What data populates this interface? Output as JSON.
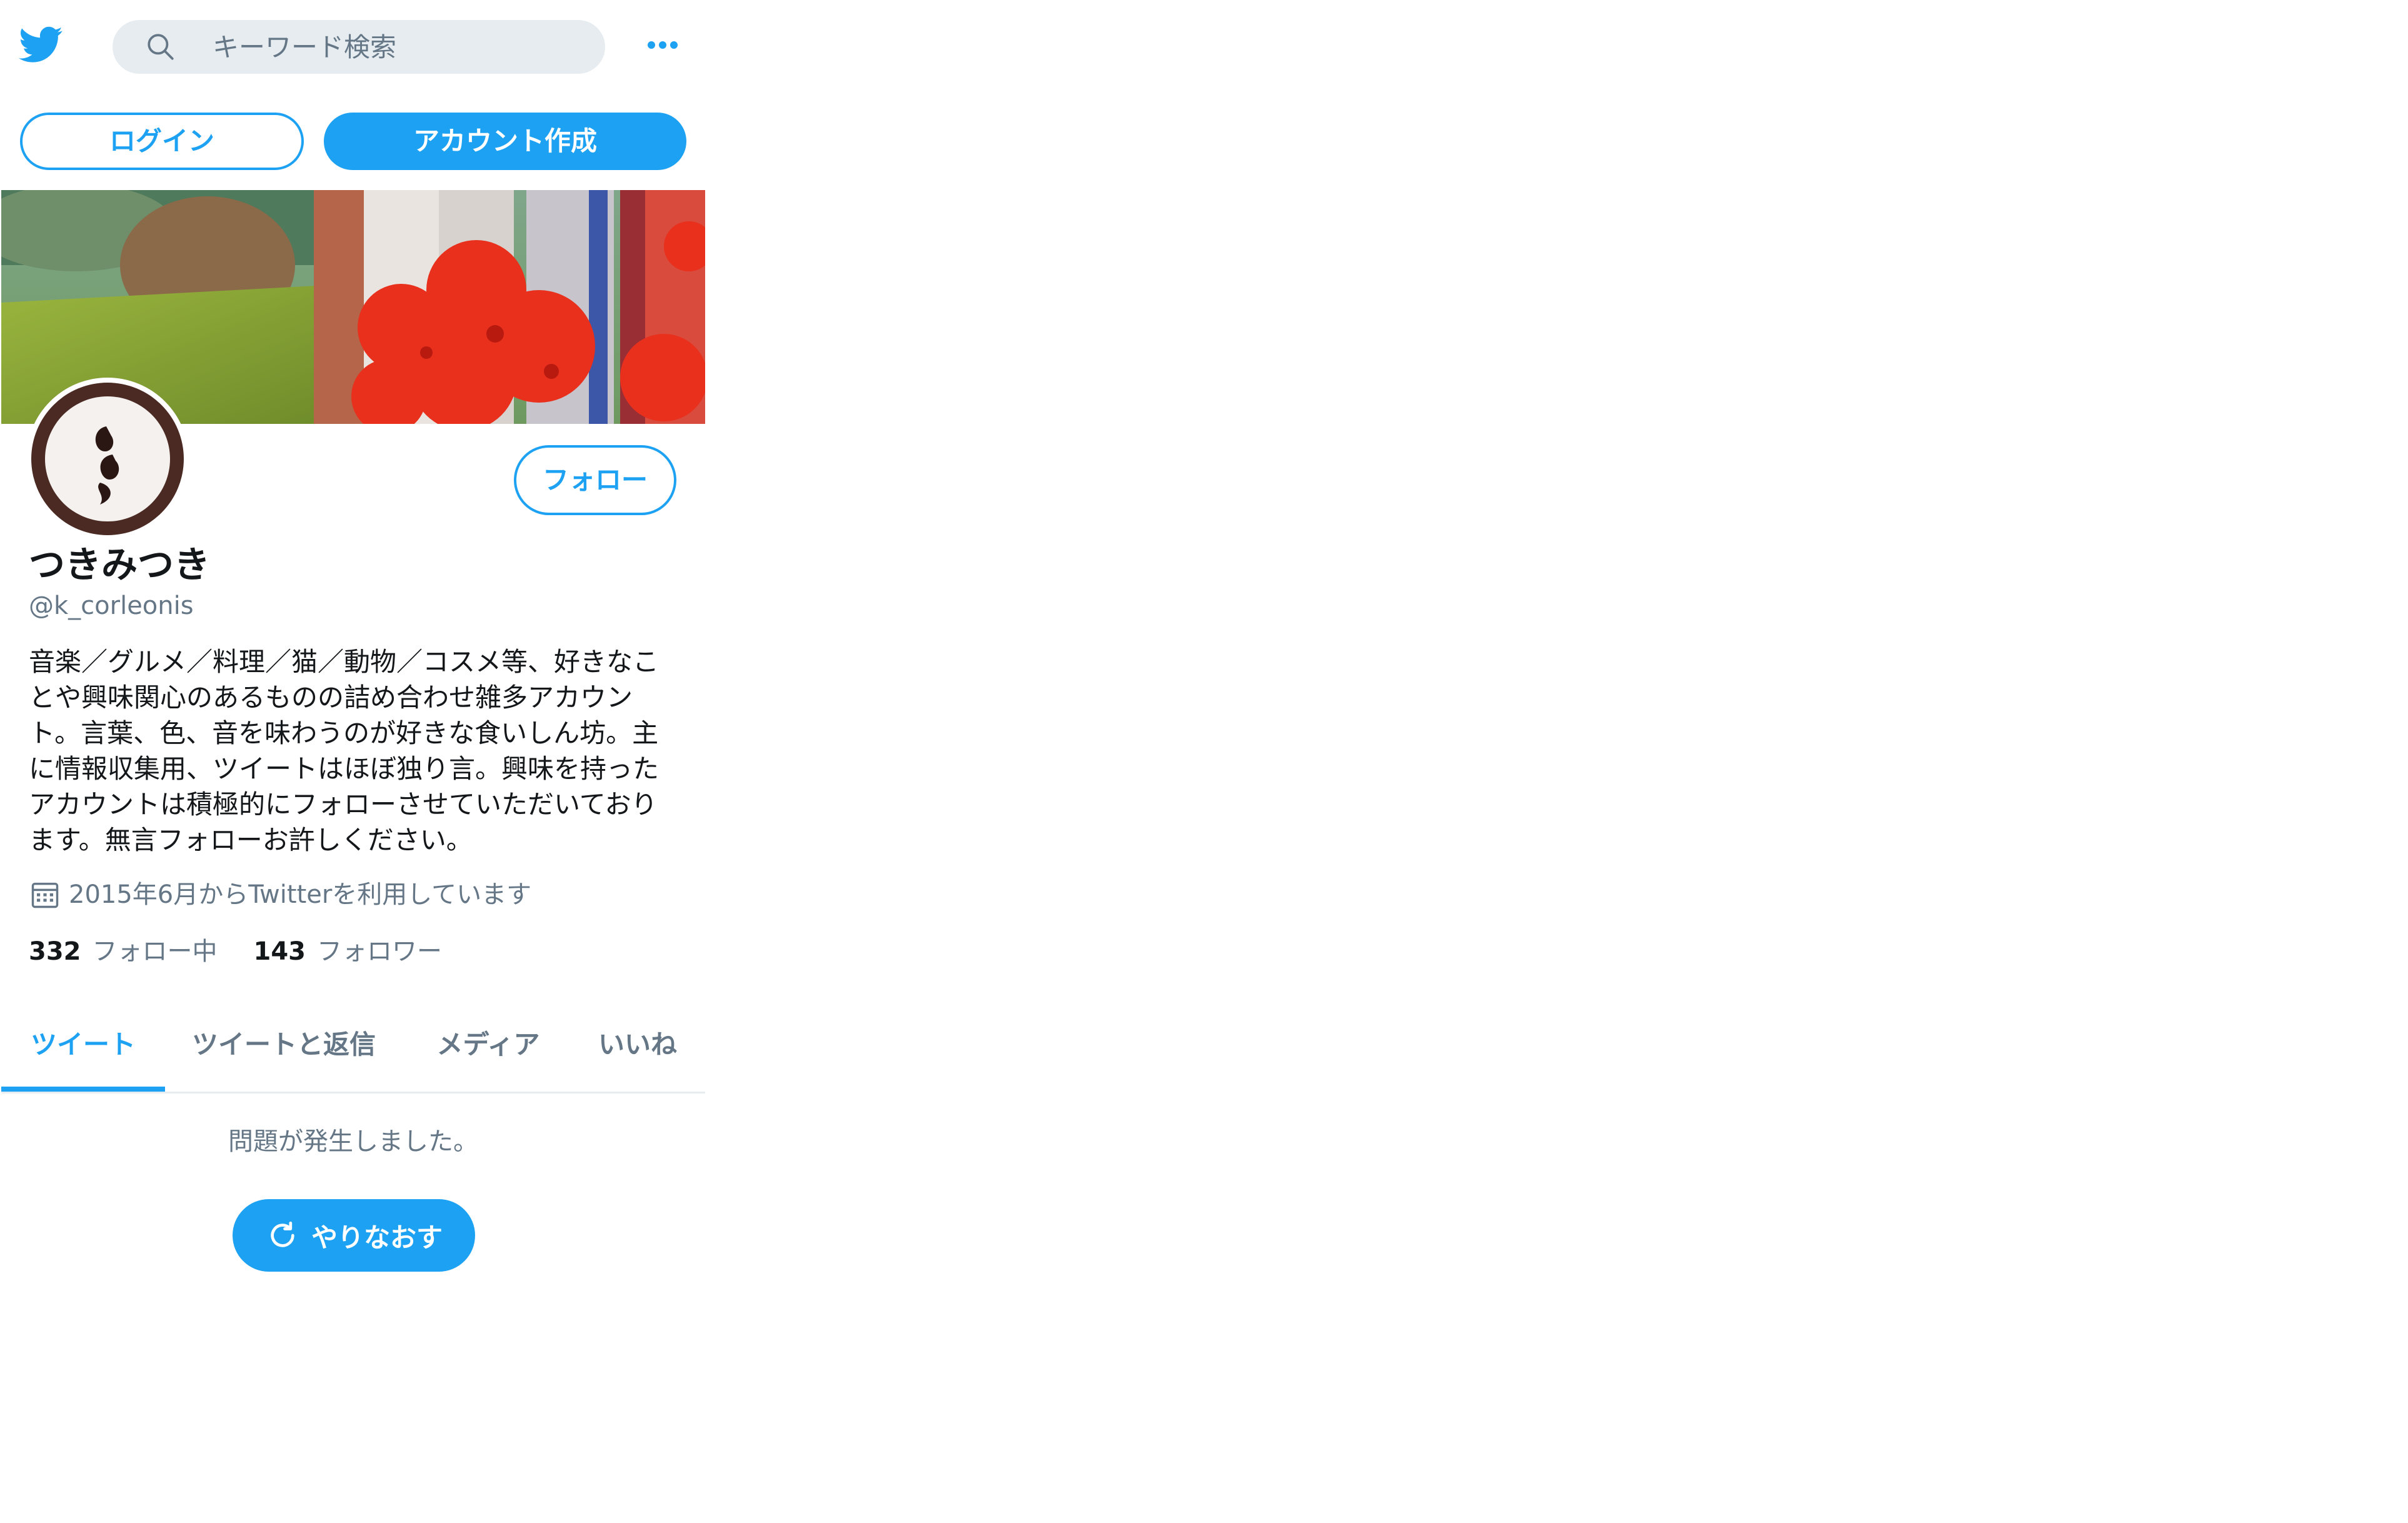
{
  "header": {
    "logo": "twitter-bird-icon",
    "search_placeholder": "キーワード検索",
    "more": "more-dots-icon"
  },
  "auth": {
    "login_label": "ログイン",
    "signup_label": "アカウント作成"
  },
  "profile": {
    "name": "つきみつき",
    "handle": "@k_corleonis",
    "follow_label": "フォロー",
    "bio": "音楽／グルメ／料理／猫／動物／コスメ等、好きなことや興味関心のあるものの詰め合わせ雑多アカウント。言葉、色、音を味わうのが好きな食いしん坊。主に情報収集用、ツイートはほぼ独り言。興味を持ったアカウントは積極的にフォローさせていただいております。無言フォローお許しください。",
    "joined": "2015年6月からTwitterを利用しています",
    "following_count": "332",
    "following_label": "フォロー中",
    "followers_count": "143",
    "followers_label": "フォロワー"
  },
  "tabs": [
    {
      "label": "ツイート",
      "active": true
    },
    {
      "label": "ツイートと返信",
      "active": false
    },
    {
      "label": "メディア",
      "active": false
    },
    {
      "label": "いいね",
      "active": false
    }
  ],
  "timeline": {
    "error_text": "問題が発生しました。",
    "retry_label": "やりなおす"
  },
  "colors": {
    "accent": "#1da1f2",
    "muted": "#657786",
    "text": "#14171a"
  }
}
